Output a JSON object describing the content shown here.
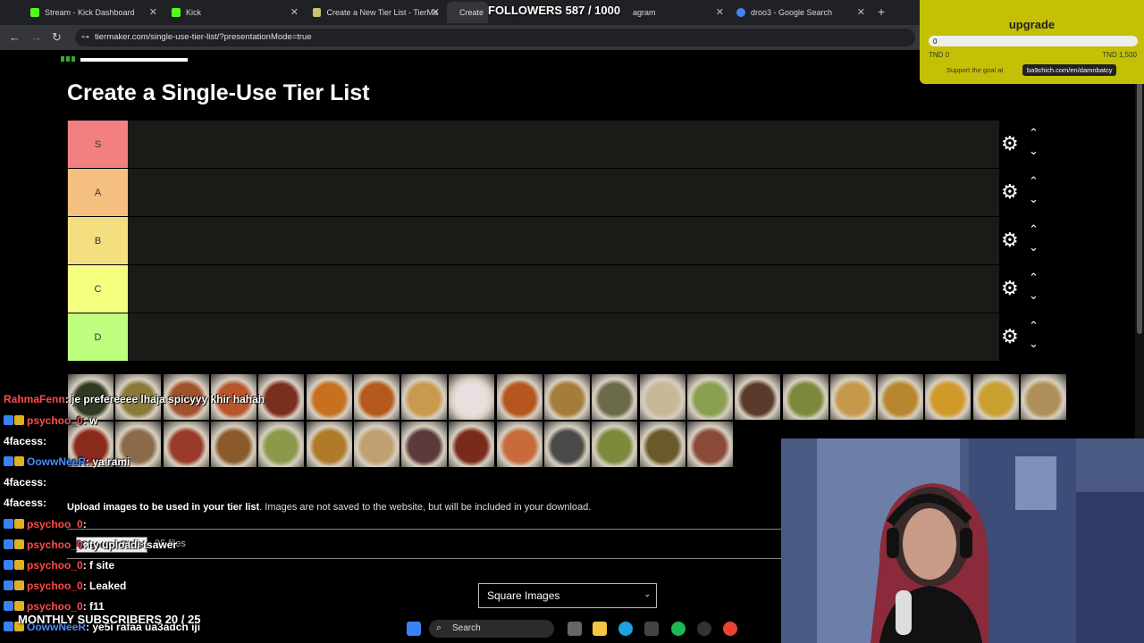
{
  "browser": {
    "tabs": [
      {
        "label": "Stream - Kick Dashboard",
        "color": "#53fc18"
      },
      {
        "label": "Kick",
        "color": "#53fc18"
      },
      {
        "label": "Create a New Tier List - TierMa",
        "color": "#c9c46a"
      },
      {
        "label": "Create",
        "color": "#c9c46a"
      },
      {
        "label": "agram",
        "color": "#e1306c"
      },
      {
        "label": "droo3 - Google Search",
        "color": "#4285f4"
      }
    ],
    "url": "tiermaker.com/single-use-tier-list/?presentationMode=true",
    "nav_icons": [
      "back-icon",
      "forward-icon",
      "reload-icon"
    ]
  },
  "page": {
    "title": "Create a Single-Use Tier List",
    "tiers": [
      {
        "label": "S",
        "color": "#f28080"
      },
      {
        "label": "A",
        "color": "#f4bf7f"
      },
      {
        "label": "B",
        "color": "#f4df80"
      },
      {
        "label": "C",
        "color": "#f4ff7f"
      },
      {
        "label": "D",
        "color": "#bfff7f"
      }
    ],
    "upload_bold": "Upload images to be used in your tier list",
    "upload_rest": ". Images are not saved to the website, but will be included in your download.",
    "choose_files": "Choose Files",
    "file_count": "35 files",
    "image_style": "Square Images"
  },
  "food_colors": [
    "#2e3a22",
    "#8a7a3a",
    "#a0522d",
    "#b8552a",
    "#7a2e1e",
    "#c7701f",
    "#b35a1c",
    "#c89a50",
    "#e8e0e0",
    "#b6561e",
    "#a67c3a",
    "#6b6b4a",
    "#c8b89a",
    "#8aa050",
    "#5a3a2a",
    "#7a8a3a",
    "#c49a4a",
    "#b8862e",
    "#d09a2a",
    "#c8a030",
    "#b0905a",
    "#8a2a1a",
    "#8a6a4a",
    "#9a3a2a",
    "#8a5a2a",
    "#8a9a4a",
    "#b07a2a",
    "#c0a070",
    "#5a3a3a",
    "#7a2a1a",
    "#c86a3a",
    "#4a4a4a",
    "#7a8a3a",
    "#6a5a2a",
    "#8a4a3a"
  ],
  "overlay": {
    "followers": "FOLLOWERS 587 / 1000",
    "goal": {
      "title": "upgrade",
      "current": "0",
      "progress": 0,
      "min": "TND 0",
      "max": "TND 1,500",
      "support": "Support the goal at",
      "link": "ba9chich.com/en/damnbatcy"
    },
    "subs": "MONTHLY SUBSCRIBERS 20 / 25",
    "chat": [
      {
        "user": "RahmaFenn",
        "text": ": je prefereeee lhaja spicyyy khir hahah",
        "color": "#ff4a4a",
        "badges": false
      },
      {
        "user": "psychoo_0",
        "text": ": w",
        "color": "#ff4a4a",
        "badges": true
      },
      {
        "user": "4facess",
        "text": ":",
        "color": "#ffffff",
        "badges": false
      },
      {
        "user": "OowwNeeR",
        "text": ": ya rami",
        "color": "#4a8cff",
        "badges": true
      },
      {
        "user": "4facess",
        "text": ":",
        "color": "#ffffff",
        "badges": false
      },
      {
        "user": "4facess",
        "text": ":",
        "color": "#ffffff",
        "badges": false
      },
      {
        "user": "psychoo_0",
        "text": ":",
        "color": "#ff4a4a",
        "badges": true
      },
      {
        "user": "psychoo_0",
        "text": ": ty uploadi tsawer",
        "color": "#ff4a4a",
        "badges": true
      },
      {
        "user": "psychoo_0",
        "text": ": f site",
        "color": "#ff4a4a",
        "badges": true
      },
      {
        "user": "psychoo_0",
        "text": ": Leaked",
        "color": "#ff4a4a",
        "badges": true
      },
      {
        "user": "psychoo_0",
        "text": ": f11",
        "color": "#ff4a4a",
        "badges": true
      },
      {
        "user": "OowwNeeR",
        "text": ": ye5i rafaa ùa3adch iji",
        "color": "#4a8cff",
        "badges": true
      }
    ]
  },
  "taskbar": {
    "search": "Search",
    "icons": [
      "windows-icon",
      "file-explorer-icon",
      "edge-icon",
      "store-icon",
      "spotify-icon",
      "obs-icon",
      "chrome-icon"
    ]
  }
}
